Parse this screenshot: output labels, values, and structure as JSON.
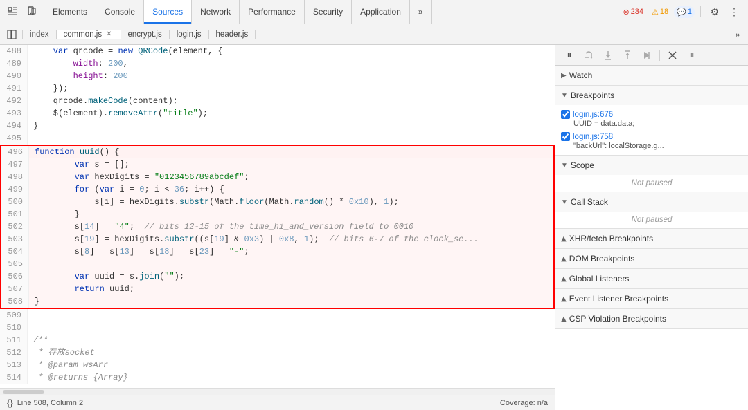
{
  "toolbar": {
    "tabs": [
      {
        "label": "Elements",
        "active": false
      },
      {
        "label": "Console",
        "active": false
      },
      {
        "label": "Sources",
        "active": true
      },
      {
        "label": "Network",
        "active": false
      },
      {
        "label": "Performance",
        "active": false
      },
      {
        "label": "Security",
        "active": false
      },
      {
        "label": "Application",
        "active": false
      },
      {
        "label": "»",
        "active": false
      }
    ],
    "error_count": "234",
    "warning_count": "18",
    "info_count": "1"
  },
  "sources": {
    "file_tabs": [
      {
        "label": "index",
        "closeable": false,
        "active": false
      },
      {
        "label": "common.js",
        "closeable": true,
        "active": true
      },
      {
        "label": "encrypt.js",
        "closeable": false,
        "active": false
      },
      {
        "label": "login.js",
        "closeable": false,
        "active": false
      },
      {
        "label": "header.js",
        "closeable": false,
        "active": false
      }
    ]
  },
  "code_lines": [
    {
      "num": 488,
      "content": "    var qrcode = new QRCode(element, {"
    },
    {
      "num": 489,
      "content": "        width: 200,"
    },
    {
      "num": 490,
      "content": "        height: 200"
    },
    {
      "num": 491,
      "content": "    });"
    },
    {
      "num": 492,
      "content": "    qrcode.makeCode(content);"
    },
    {
      "num": 493,
      "content": "    $(element).removeAttr(\"title\");"
    },
    {
      "num": 494,
      "content": "}"
    },
    {
      "num": 495,
      "content": ""
    },
    {
      "num": 496,
      "content": "function uuid() {",
      "highlight_start": true
    },
    {
      "num": 497,
      "content": "        var s = [];"
    },
    {
      "num": 498,
      "content": "        var hexDigits = \"0123456789abcdef\";"
    },
    {
      "num": 499,
      "content": "        for (var i = 0; i < 36; i++) {"
    },
    {
      "num": 500,
      "content": "            s[i] = hexDigits.substr(Math.floor(Math.random() * 0x10), 1);"
    },
    {
      "num": 501,
      "content": "        }"
    },
    {
      "num": 502,
      "content": "        s[14] = \"4\";  // bits 12-15 of the time_hi_and_version field to 0010"
    },
    {
      "num": 503,
      "content": "        s[19] = hexDigits.substr((s[19] & 0x3) | 0x8, 1);  // bits 6-7 of the clock_se..."
    },
    {
      "num": 504,
      "content": "        s[8] = s[13] = s[18] = s[23] = \"-\";"
    },
    {
      "num": 505,
      "content": ""
    },
    {
      "num": 506,
      "content": "        var uuid = s.join(\"\");"
    },
    {
      "num": 507,
      "content": "        return uuid;"
    },
    {
      "num": 508,
      "content": "}",
      "highlight_end": true
    },
    {
      "num": 509,
      "content": ""
    },
    {
      "num": 510,
      "content": ""
    },
    {
      "num": 511,
      "content": "/**"
    },
    {
      "num": 512,
      "content": " * 存放socket"
    },
    {
      "num": 513,
      "content": " * @param wsArr"
    },
    {
      "num": 514,
      "content": " * @returns {Array}"
    }
  ],
  "status_bar": {
    "icon": "{}",
    "position": "Line 508, Column 2",
    "coverage": "Coverage: n/a"
  },
  "right_panel": {
    "watch_label": "Watch",
    "breakpoints_label": "Breakpoints",
    "breakpoints": [
      {
        "location": "login.js:676",
        "code": "UUID = data.data;"
      },
      {
        "location": "login.js:758",
        "code": "\"backUrl\": localStorage.g..."
      }
    ],
    "scope_label": "Scope",
    "scope_status": "Not paused",
    "call_stack_label": "Call Stack",
    "call_stack_status": "Not paused",
    "xhr_label": "XHR/fetch Breakpoints",
    "dom_label": "DOM Breakpoints",
    "global_label": "Global Listeners",
    "event_label": "Event Listener Breakpoints",
    "csp_label": "CSP Violation Breakpoints"
  },
  "debug_buttons": {
    "pause": "⏸",
    "step_over": "↺",
    "step_into": "↓",
    "step_out": "↑",
    "step": "→",
    "deactivate": "⊘",
    "pause_on_exception": "⏸"
  }
}
